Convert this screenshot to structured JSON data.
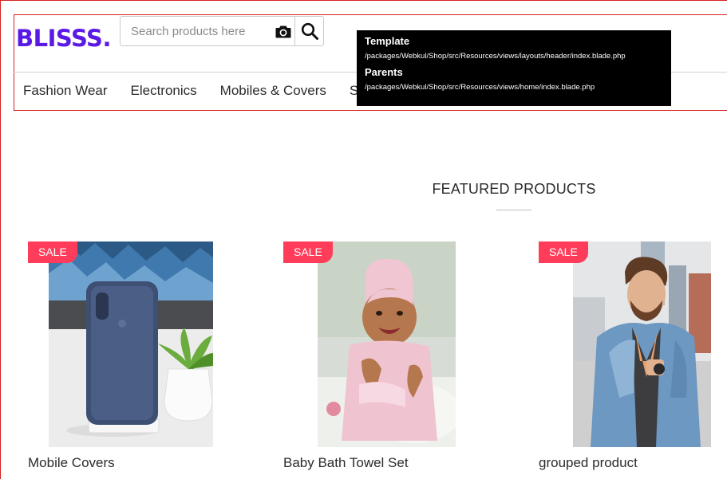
{
  "header": {
    "logo_text": "BLISSS",
    "logo_dot": ".",
    "brand_color": "#5b19e6",
    "search": {
      "placeholder": "Search products here",
      "value": ""
    },
    "camera_icon": "camera-icon",
    "search_icon": "search-icon"
  },
  "nav": {
    "items": [
      "Fashion Wear",
      "Electronics",
      "Mobiles & Covers",
      "S"
    ]
  },
  "debug_tooltip": {
    "template_label": "Template",
    "template_path": "/packages/Webkul/Shop/src/Resources/views/layouts/header/index.blade.php",
    "parents_label": "Parents",
    "parents_path": "/packages/Webkul/Shop/src/Resources/views/home/index.blade.php"
  },
  "featured": {
    "title": "FEATURED PRODUCTS",
    "products": [
      {
        "name": "Mobile Covers",
        "badge": "SALE"
      },
      {
        "name": "Baby Bath Towel Set",
        "badge": "SALE"
      },
      {
        "name": "grouped product",
        "badge": "SALE"
      }
    ]
  },
  "colors": {
    "sale_badge": "#ff3d5a",
    "highlight_border": "#d61f1f"
  }
}
